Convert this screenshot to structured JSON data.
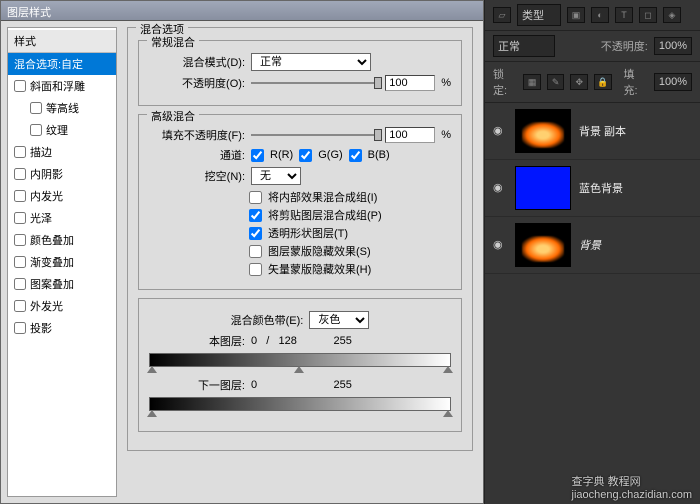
{
  "dialog": {
    "title": "图层样式",
    "styles_header": "样式",
    "blend_options_label": "混合选项:自定",
    "style_items": [
      {
        "label": "斜面和浮雕",
        "checked": false
      },
      {
        "label": "等高线",
        "checked": false,
        "sub": true
      },
      {
        "label": "纹理",
        "checked": false,
        "sub": true
      },
      {
        "label": "描边",
        "checked": false
      },
      {
        "label": "内阴影",
        "checked": false
      },
      {
        "label": "内发光",
        "checked": false
      },
      {
        "label": "光泽",
        "checked": false
      },
      {
        "label": "颜色叠加",
        "checked": false
      },
      {
        "label": "渐变叠加",
        "checked": false
      },
      {
        "label": "图案叠加",
        "checked": false
      },
      {
        "label": "外发光",
        "checked": false
      },
      {
        "label": "投影",
        "checked": false
      }
    ],
    "blend_options_title": "混合选项",
    "general_title": "常规混合",
    "blend_mode_label": "混合模式(D):",
    "blend_mode_value": "正常",
    "opacity_label": "不透明度(O):",
    "opacity_value": "100",
    "percent": "%",
    "advanced_title": "高级混合",
    "fill_opacity_label": "填充不透明度(F):",
    "fill_opacity_value": "100",
    "channels_label": "通道:",
    "channel_r": "R(R)",
    "channel_g": "G(G)",
    "channel_b": "B(B)",
    "knockout_label": "挖空(N):",
    "knockout_value": "无",
    "checks": [
      {
        "label": "将内部效果混合成组(I)",
        "checked": false
      },
      {
        "label": "将剪贴图层混合成组(P)",
        "checked": true
      },
      {
        "label": "透明形状图层(T)",
        "checked": true
      },
      {
        "label": "图层蒙版隐藏效果(S)",
        "checked": false
      },
      {
        "label": "矢量蒙版隐藏效果(H)",
        "checked": false
      }
    ],
    "blend_if_label": "混合颜色带(E):",
    "blend_if_value": "灰色",
    "this_layer_label": "本图层:",
    "this_layer_vals": "0   /   128            255",
    "under_layer_label": "下一图层:",
    "under_layer_vals": "0                         255"
  },
  "panel": {
    "kind_label": "类型",
    "mode": "正常",
    "opacity_label": "不透明度:",
    "opacity": "100%",
    "lock_label": "锁定:",
    "fill_label": "填充:",
    "fill": "100%",
    "layers": [
      {
        "name": "背景 副本",
        "type": "fire"
      },
      {
        "name": "蓝色背景",
        "type": "blue"
      },
      {
        "name": "背景",
        "type": "fire",
        "italic": true
      }
    ]
  },
  "watermark": {
    "line1": "查字典 教程网",
    "line2": "jiaocheng.chazidian.com"
  }
}
